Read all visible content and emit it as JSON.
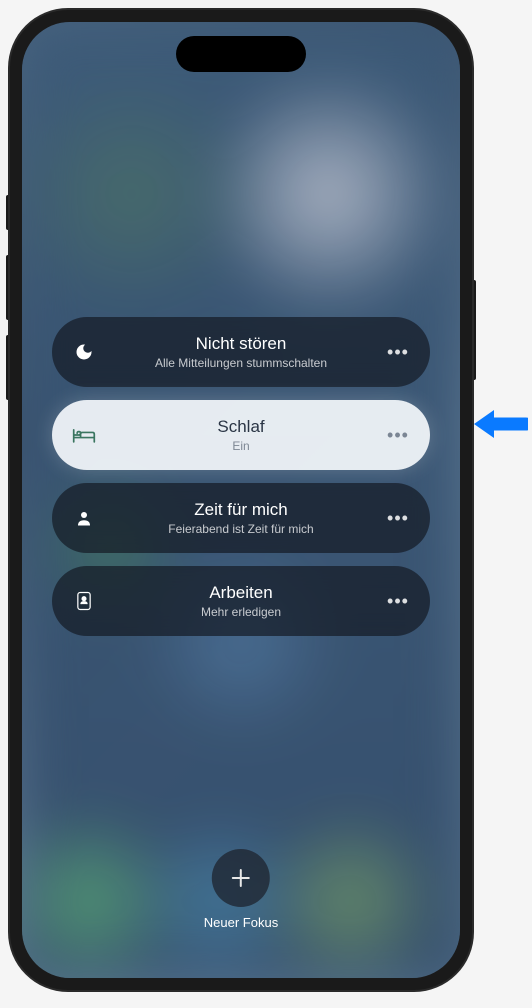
{
  "focus_modes": [
    {
      "icon": "moon",
      "title": "Nicht stören",
      "subtitle": "Alle Mitteilungen stummschalten",
      "active": false
    },
    {
      "icon": "bed",
      "title": "Schlaf",
      "subtitle": "Ein",
      "active": true
    },
    {
      "icon": "person",
      "title": "Zeit für mich",
      "subtitle": "Feierabend ist Zeit für mich",
      "active": false
    },
    {
      "icon": "badge",
      "title": "Arbeiten",
      "subtitle": "Mehr erledigen",
      "active": false
    }
  ],
  "new_focus": {
    "label": "Neuer Fokus"
  },
  "colors": {
    "accent_blue": "#0a84ff",
    "active_bg": "rgba(245, 248, 252, 0.92)",
    "dark_bg": "rgba(20, 25, 35, 0.7)"
  }
}
